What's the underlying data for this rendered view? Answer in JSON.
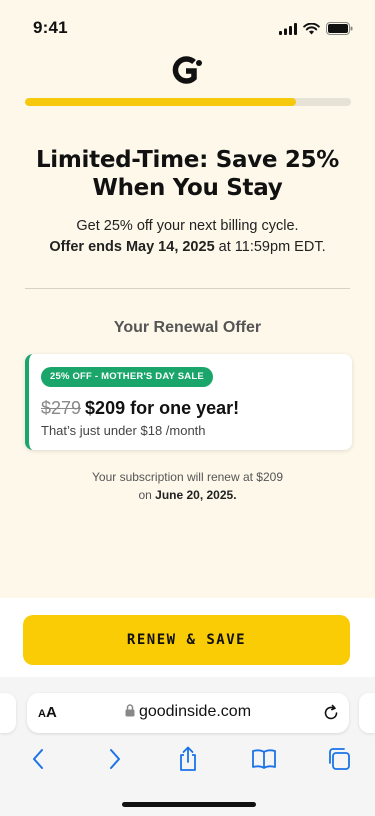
{
  "status_bar": {
    "time": "9:41"
  },
  "progress": {
    "percent": 83
  },
  "headline": {
    "line1": "Limited-Time: Save 25%",
    "line2": "When You Stay"
  },
  "subtext": {
    "line1": "Get 25% off your next billing cycle.",
    "offer_ends_bold": "Offer ends May 14, 2025",
    "offer_ends_time": " at 11:59pm EDT."
  },
  "offer": {
    "section_title": "Your Renewal Offer",
    "badge": "25% OFF - MOTHER'S DAY SALE",
    "old_price": "$279",
    "new_price": "$209 for one year!",
    "monthly": "That’s just under $18 /month"
  },
  "renew_note": {
    "line1": "Your subscription will renew at $209",
    "line2_prefix": "on ",
    "line2_date": "June 20, 2025."
  },
  "cta": {
    "label": "RENEW & SAVE"
  },
  "browser": {
    "aa_label": "AA",
    "url": "goodinside.com"
  },
  "colors": {
    "accent_yellow": "#f9cc05",
    "badge_green": "#1aa66a",
    "background": "#fdf8ea",
    "ios_blue": "#1a73e8"
  },
  "icons": [
    "signal-icon",
    "wifi-icon",
    "battery-icon",
    "logo-icon",
    "lock-icon",
    "reload-icon",
    "back-icon",
    "forward-icon",
    "share-icon",
    "bookmarks-icon",
    "tabs-icon"
  ]
}
